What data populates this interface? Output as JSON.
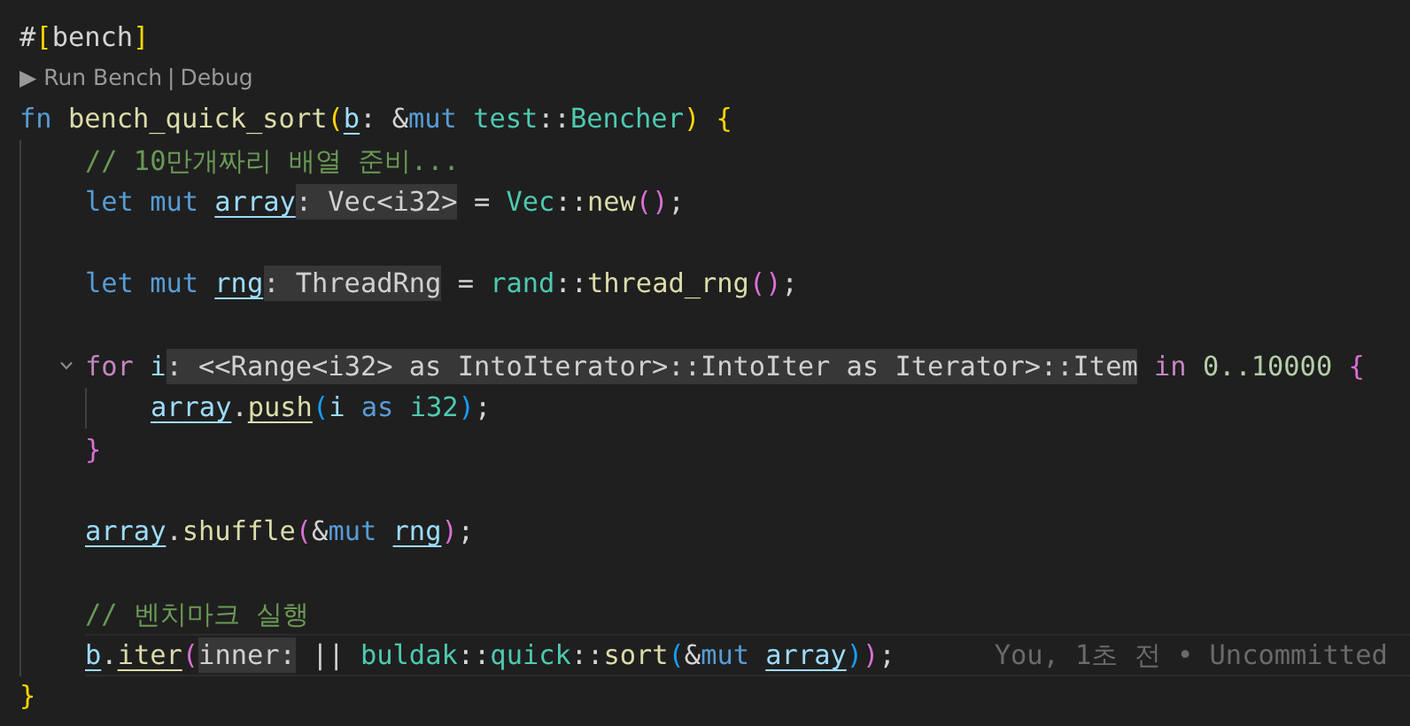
{
  "editor": {
    "lines": [
      {
        "kind": "code",
        "current": false,
        "tokens": [
          {
            "text": "#",
            "kind": "plain"
          },
          {
            "text": "[",
            "kind": "bracket1"
          },
          {
            "text": "bench",
            "kind": "plain"
          },
          {
            "text": "]",
            "kind": "bracket1"
          }
        ]
      },
      {
        "kind": "codelens",
        "items": [
          "▶ Run Bench",
          "Debug"
        ],
        "separator": "|"
      },
      {
        "kind": "code",
        "current": false,
        "tokens": [
          {
            "text": "fn ",
            "kind": "keyword"
          },
          {
            "text": "bench_quick_sort",
            "kind": "function"
          },
          {
            "text": "(",
            "kind": "bracket1"
          },
          {
            "text": "b",
            "kind": "variable_mut"
          },
          {
            "text": ": &",
            "kind": "plain"
          },
          {
            "text": "mut ",
            "kind": "keyword"
          },
          {
            "text": "test",
            "kind": "type"
          },
          {
            "text": "::",
            "kind": "plain"
          },
          {
            "text": "Bencher",
            "kind": "type"
          },
          {
            "text": ") ",
            "kind": "bracket1"
          },
          {
            "text": "{",
            "kind": "bracket1"
          }
        ],
        "children": [
          {
            "kind": "code",
            "current": false,
            "tokens": [
              {
                "text": "// 10만개짜리 배열 준비...",
                "kind": "comment"
              }
            ]
          },
          {
            "kind": "code",
            "current": false,
            "tokens": [
              {
                "text": "let mut ",
                "kind": "keyword"
              },
              {
                "text": "array",
                "kind": "variable_mut"
              },
              {
                "text": ": Vec<i32>",
                "kind": "hint"
              },
              {
                "text": " = ",
                "kind": "plain"
              },
              {
                "text": "Vec",
                "kind": "type"
              },
              {
                "text": "::",
                "kind": "plain"
              },
              {
                "text": "new",
                "kind": "function"
              },
              {
                "text": "()",
                "kind": "bracket2"
              },
              {
                "text": ";",
                "kind": "plain"
              }
            ]
          },
          {
            "kind": "blank",
            "current": false
          },
          {
            "kind": "code",
            "current": false,
            "tokens": [
              {
                "text": "let mut ",
                "kind": "keyword"
              },
              {
                "text": "rng",
                "kind": "variable_mut"
              },
              {
                "text": ": ThreadRng",
                "kind": "hint"
              },
              {
                "text": " = ",
                "kind": "plain"
              },
              {
                "text": "rand",
                "kind": "type"
              },
              {
                "text": "::",
                "kind": "plain"
              },
              {
                "text": "thread_rng",
                "kind": "function"
              },
              {
                "text": "()",
                "kind": "bracket2"
              },
              {
                "text": ";",
                "kind": "plain"
              }
            ]
          },
          {
            "kind": "blank",
            "current": false
          },
          {
            "kind": "code",
            "current": false,
            "tokens": [
              {
                "text": "for ",
                "kind": "control"
              },
              {
                "text": "i",
                "kind": "variable"
              },
              {
                "text": ": <<Range<i32> as IntoIterator>::IntoIter as Iterator>::Item",
                "kind": "hint"
              },
              {
                "text": " in ",
                "kind": "control"
              },
              {
                "text": "0..10000 ",
                "kind": "number"
              },
              {
                "text": "{",
                "kind": "bracket2"
              }
            ],
            "children": [
              {
                "kind": "code",
                "current": false,
                "tokens": [
                  {
                    "text": "array",
                    "kind": "variable_mut"
                  },
                  {
                    "text": ".",
                    "kind": "plain"
                  },
                  {
                    "text": "push",
                    "kind": "method_mut"
                  },
                  {
                    "text": "(",
                    "kind": "bracket3"
                  },
                  {
                    "text": "i ",
                    "kind": "variable"
                  },
                  {
                    "text": "as ",
                    "kind": "keyword"
                  },
                  {
                    "text": "i32",
                    "kind": "type"
                  },
                  {
                    "text": ")",
                    "kind": "bracket3"
                  },
                  {
                    "text": ";",
                    "kind": "plain"
                  }
                ]
              }
            ],
            "end": [
              {
                "text": "}",
                "kind": "bracket2"
              }
            ]
          },
          {
            "kind": "blank",
            "current": false
          },
          {
            "kind": "code",
            "current": false,
            "tokens": [
              {
                "text": "array",
                "kind": "variable_mut"
              },
              {
                "text": ".",
                "kind": "plain"
              },
              {
                "text": "shuffle",
                "kind": "function"
              },
              {
                "text": "(",
                "kind": "bracket2"
              },
              {
                "text": "&",
                "kind": "plain"
              },
              {
                "text": "mut ",
                "kind": "keyword"
              },
              {
                "text": "rng",
                "kind": "variable_mut"
              },
              {
                "text": ")",
                "kind": "bracket2"
              },
              {
                "text": ";",
                "kind": "plain"
              }
            ]
          },
          {
            "kind": "blank",
            "current": false
          },
          {
            "kind": "code",
            "current": false,
            "tokens": [
              {
                "text": "// 벤치마크 실행",
                "kind": "comment"
              }
            ]
          },
          {
            "kind": "code",
            "current": true,
            "blame": "You, 1초 전 • Uncommitted",
            "tokens": [
              {
                "text": "b",
                "kind": "variable_mut"
              },
              {
                "text": ".",
                "kind": "plain"
              },
              {
                "text": "iter",
                "kind": "method_mut"
              },
              {
                "text": "(",
                "kind": "bracket2"
              },
              {
                "text": "inner:",
                "kind": "hint"
              },
              {
                "text": " || ",
                "kind": "plain"
              },
              {
                "text": "buldak",
                "kind": "type"
              },
              {
                "text": "::",
                "kind": "plain"
              },
              {
                "text": "quick",
                "kind": "type"
              },
              {
                "text": "::",
                "kind": "plain"
              },
              {
                "text": "sort",
                "kind": "function"
              },
              {
                "text": "(",
                "kind": "bracket3"
              },
              {
                "text": "&",
                "kind": "plain"
              },
              {
                "text": "mut ",
                "kind": "keyword"
              },
              {
                "text": "array",
                "kind": "variable_mut"
              },
              {
                "text": ")",
                "kind": "bracket3"
              },
              {
                "text": ")",
                "kind": "bracket2"
              },
              {
                "text": ";",
                "kind": "plain"
              }
            ]
          }
        ],
        "end": [
          {
            "text": "}",
            "kind": "bracket1"
          }
        ]
      }
    ]
  }
}
